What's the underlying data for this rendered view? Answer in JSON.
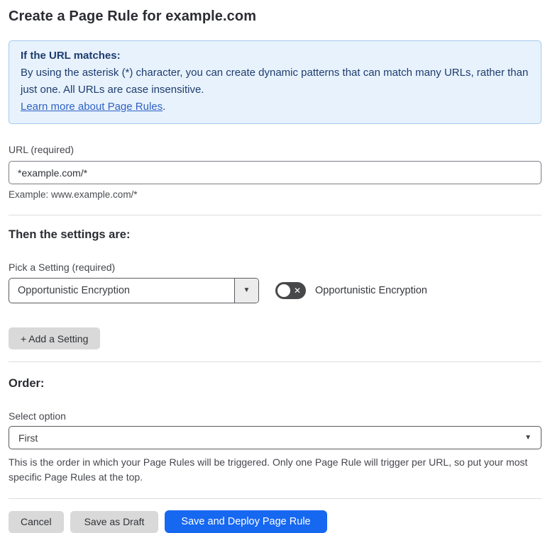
{
  "page_title": "Create a Page Rule for example.com",
  "info_box": {
    "heading": "If the URL matches:",
    "body": "By using the asterisk (*) character, you can create dynamic patterns that can match many URLs, rather than just one. All URLs are case insensitive.",
    "link_label": "Learn more about Page Rules",
    "link_suffix": "."
  },
  "url_field": {
    "label": "URL (required)",
    "value": "*example.com/*",
    "helper": "Example: www.example.com/*"
  },
  "settings_section": {
    "heading": "Then the settings are:",
    "picker_label": "Pick a Setting (required)",
    "picker_value": "Opportunistic Encryption",
    "toggle_state": "off",
    "toggle_label": "Opportunistic Encryption",
    "add_setting_button": "+ Add a Setting"
  },
  "order_section": {
    "heading": "Order:",
    "select_label": "Select option",
    "select_value": "First",
    "helper": "This is the order in which your Page Rules will be triggered. Only one Page Rule will trigger per URL, so put your most specific Page Rules at the top."
  },
  "footer": {
    "cancel_label": "Cancel",
    "save_draft_label": "Save as Draft",
    "save_deploy_label": "Save and Deploy Page Rule"
  },
  "icons": {
    "dropdown_caret": "▼",
    "toggle_off_x": "✕"
  },
  "colors": {
    "accent_blue": "#1768f0",
    "info_bg": "#e8f2fc",
    "info_border": "#a3c9ef",
    "info_text": "#1d3c6e",
    "link_blue": "#2f62c4",
    "toggle_off_bg": "#47484a",
    "gray_button_bg": "#d9d9d9"
  }
}
